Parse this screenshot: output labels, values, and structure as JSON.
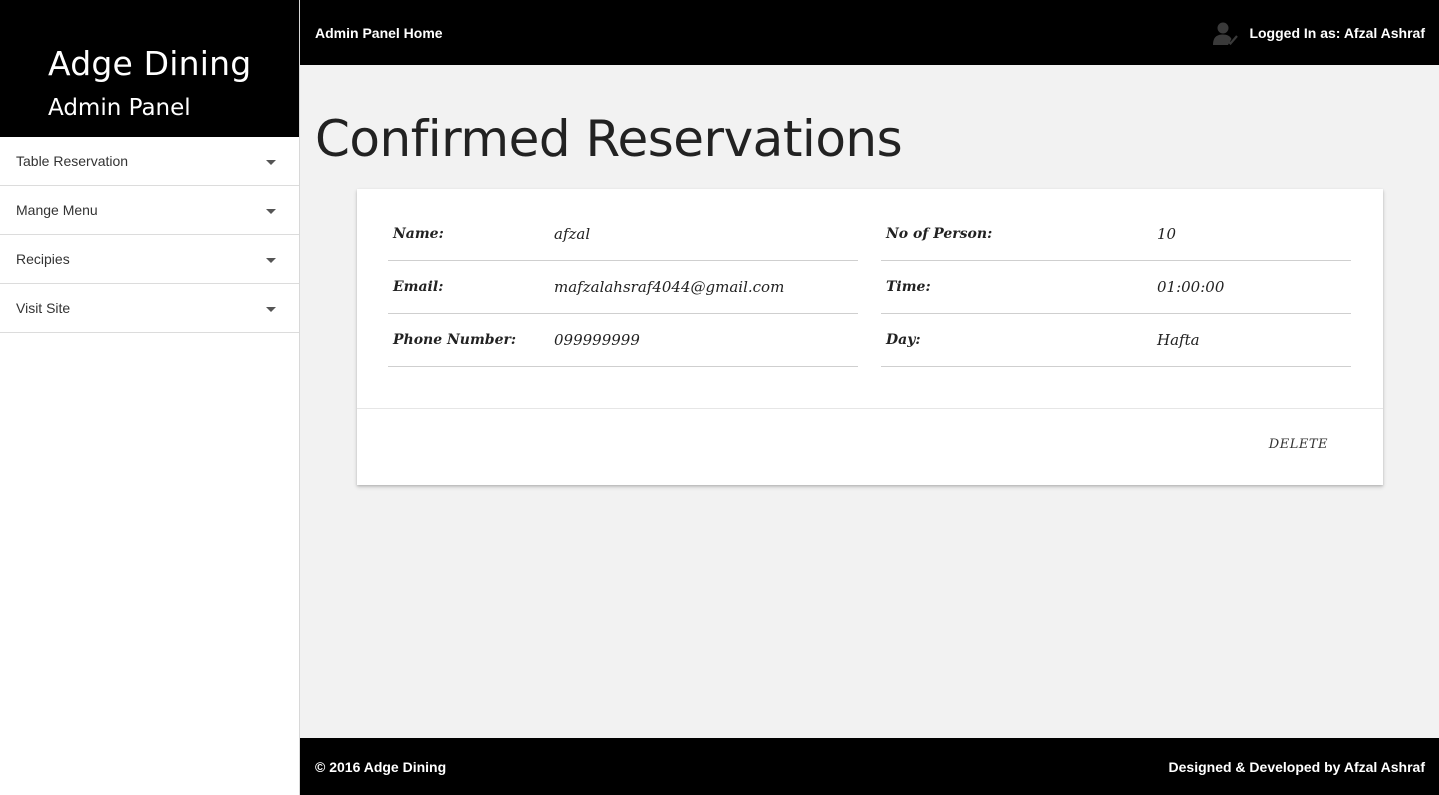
{
  "brand": {
    "name": "Adge Dining",
    "subtitle": "Admin Panel"
  },
  "sidebar": {
    "items": [
      {
        "label": "Table Reservation",
        "icon": "caret-down-icon"
      },
      {
        "label": "Mange Menu",
        "icon": "caret-down-icon"
      },
      {
        "label": "Recipies",
        "icon": "caret-down-icon"
      },
      {
        "label": "Visit Site",
        "icon": "caret-down-icon"
      }
    ]
  },
  "topbar": {
    "home_label": "Admin Panel Home",
    "user_label": "Logged In as: Afzal Ashraf",
    "user_icon": "user-avatar-icon"
  },
  "main": {
    "title": "Confirmed Reservations",
    "reservation": {
      "left": [
        {
          "label": "Name:",
          "value": "afzal"
        },
        {
          "label": "Email:",
          "value": "mafzalahsraf4044@gmail.com"
        },
        {
          "label": "Phone Number:",
          "value": "099999999"
        }
      ],
      "right": [
        {
          "label": "No of Person:",
          "value": "10"
        },
        {
          "label": "Time:",
          "value": "01:00:00"
        },
        {
          "label": "Day:",
          "value": "Hafta"
        }
      ],
      "delete_label": "DELETE"
    }
  },
  "footer": {
    "copyright": "© 2016 Adge Dining",
    "credit": "Designed & Developed by Afzal Ashraf"
  },
  "colors": {
    "header_bg": "#000000",
    "page_bg": "#f2f2f2",
    "card_bg": "#ffffff"
  }
}
